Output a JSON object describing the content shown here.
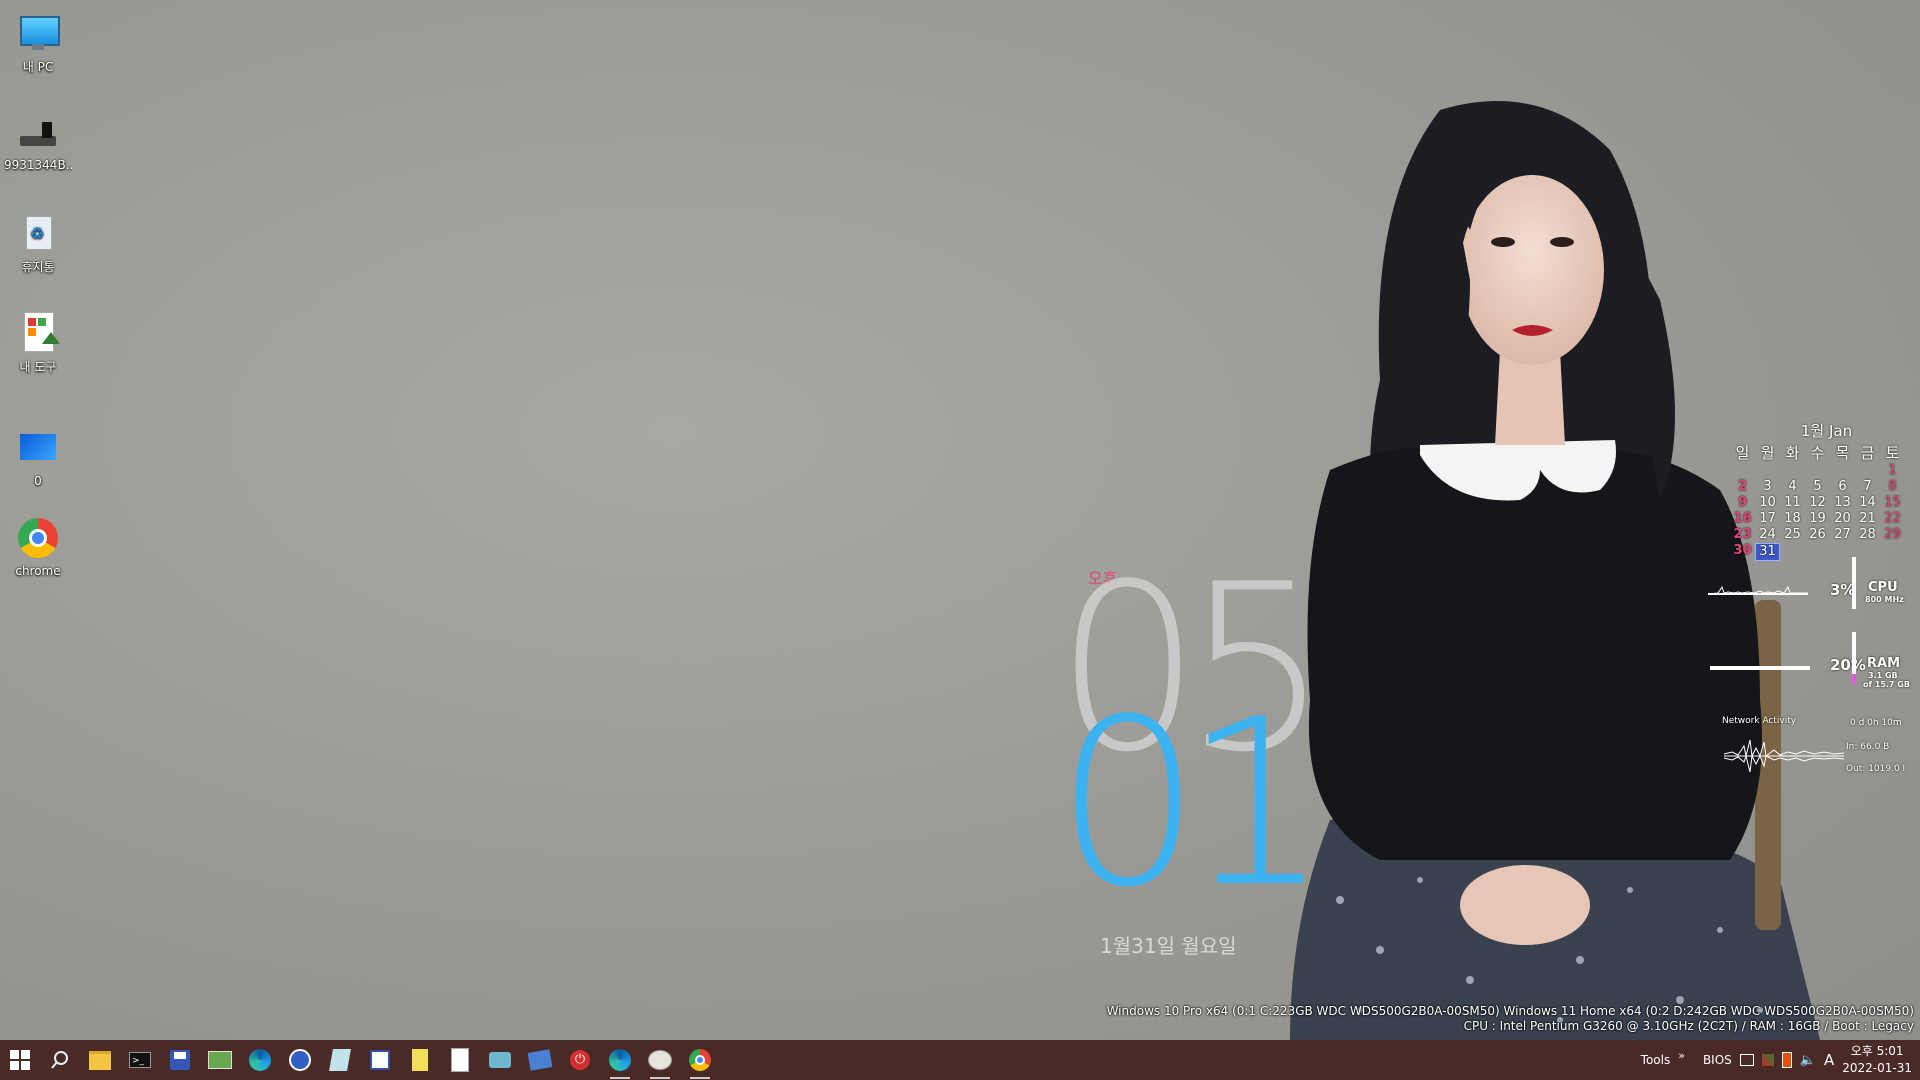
{
  "desktop": {
    "icons": [
      {
        "label": "내 PC",
        "icon": "monitor-icon"
      },
      {
        "label": "9931344B...",
        "icon": "usb-drive-icon"
      },
      {
        "label": "휴지통",
        "icon": "recycle-bin-icon"
      },
      {
        "label": "내 도구",
        "icon": "tools-shortcut-icon"
      },
      {
        "label": "0",
        "icon": "window-icon"
      },
      {
        "label": "chrome",
        "icon": "chrome-icon"
      }
    ]
  },
  "clock": {
    "ampm": "오후",
    "hour": "05",
    "minute": "01",
    "date": "1월31일  월요일"
  },
  "calendar": {
    "title": "1월 Jan",
    "weekdays": [
      "일",
      "월",
      "화",
      "수",
      "목",
      "금",
      "토"
    ],
    "weeks": [
      [
        "",
        "",
        "",
        "",
        "",
        "",
        "1"
      ],
      [
        "2",
        "3",
        "4",
        "5",
        "6",
        "7",
        "8"
      ],
      [
        "9",
        "10",
        "11",
        "12",
        "13",
        "14",
        "15"
      ],
      [
        "16",
        "17",
        "18",
        "19",
        "20",
        "21",
        "22"
      ],
      [
        "23",
        "24",
        "25",
        "26",
        "27",
        "28",
        "29"
      ],
      [
        "30",
        "31",
        "",
        "",
        "",
        "",
        ""
      ]
    ],
    "today": "31"
  },
  "monitors": {
    "cpu": {
      "percent": "3%",
      "name": "CPU",
      "sub": "800 MHz"
    },
    "ram": {
      "percent": "20%",
      "name": "RAM",
      "sub1": "3.1 GB",
      "sub2": "of 15.7 GB"
    },
    "network": {
      "title": "Network Activity",
      "uptime": "0 d 0h 10m",
      "in": "In: 66.0 B",
      "out": "Out: 1019.0 I"
    }
  },
  "sysinfo": {
    "line1": "Windows 10 Pro x64 (0:1 C:223GB WDC  WDS500G2B0A-00SM50) Windows 11 Home x64 (0:2 D:242GB WDC  WDS500G2B0A-00SM50)",
    "line2": "CPU : Intel Pentium G3260 @ 3.10GHz (2C2T) / RAM : 16GB / Boot : Legacy"
  },
  "taskbar": {
    "tray_tools": "Tools",
    "tray_overflow": "»",
    "tray_bios": "BIOS",
    "ime": "A",
    "time": "오후 5:01",
    "date": "2022-01-31"
  },
  "colors": {
    "accent_blue": "#3cb3f0",
    "accent_pink": "#e0447a",
    "taskbar": "#4a2a26"
  }
}
